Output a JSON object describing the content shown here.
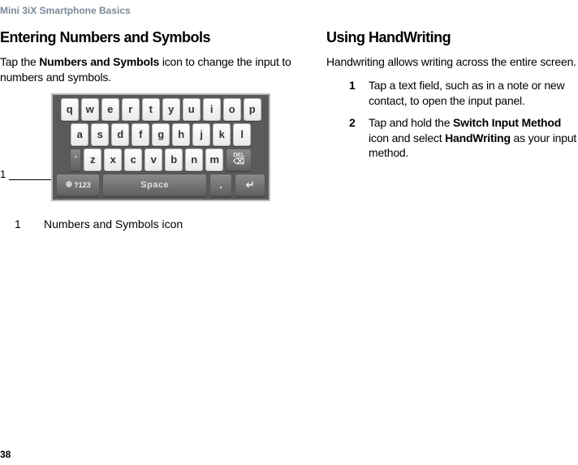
{
  "header": "Mini 3iX Smartphone Basics",
  "page_number": "38",
  "left": {
    "title": "Entering Numbers and Symbols",
    "para_pre": "Tap the ",
    "para_bold": "Numbers and Symbols",
    "para_post": " icon to change the input to numbers and symbols.",
    "callout_label": "1",
    "legend_num": "1",
    "legend_text": "Numbers and Symbols icon",
    "keyboard": {
      "row1": [
        "q",
        "w",
        "e",
        "r",
        "t",
        "y",
        "u",
        "i",
        "o",
        "p"
      ],
      "row2": [
        "a",
        "s",
        "d",
        "f",
        "g",
        "h",
        "j",
        "k",
        "l"
      ],
      "row3_tick": "'",
      "row3_letters": [
        "z",
        "x",
        "c",
        "v",
        "b",
        "n",
        "m"
      ],
      "row3_del_top": "DEL",
      "row3_del_icon": "⌫",
      "row4_num": "?123",
      "row4_globe": "⊕",
      "row4_space": "Space",
      "row4_dot": ".",
      "row4_enter": "↵"
    }
  },
  "right": {
    "title": "Using HandWriting",
    "intro": "Handwriting allows writing across the entire screen.",
    "steps": [
      {
        "n": "1",
        "text": "Tap a text field, such as in a note or new contact, to open the input panel."
      },
      {
        "n": "2",
        "pre": "Tap and hold the ",
        "b1": "Switch Input Method",
        "mid": " icon and select ",
        "b2": "HandWriting",
        "post": " as your input method."
      }
    ]
  }
}
